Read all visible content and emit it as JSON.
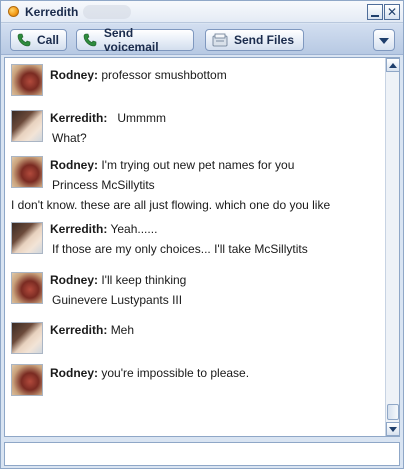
{
  "window": {
    "title": "Kerredith",
    "minimize_label": "",
    "close_label": "✕"
  },
  "toolbar": {
    "call_label": "Call",
    "voicemail_label": "Send voicemail",
    "files_label": "Send Files",
    "menu_icon": "chevron-down-icon"
  },
  "messages": [
    {
      "sender": "Rodney:",
      "lines": [
        "professor smushbottom"
      ]
    },
    {
      "sender": "Kerredith:",
      "lines": [
        "Ummmm",
        "What?"
      ]
    },
    {
      "sender": "Rodney:",
      "lines": [
        "I'm trying out new pet names for you",
        "Princess McSillytits",
        "I don't know. these are all just flowing. which one do you like"
      ]
    },
    {
      "sender": "Kerredith:",
      "lines": [
        "Yeah......",
        "If those are my only choices... I'll take McSillytits"
      ]
    },
    {
      "sender": "Rodney:",
      "lines": [
        "I'll keep thinking",
        "Guinevere Lustypants III"
      ]
    },
    {
      "sender": "Kerredith:",
      "lines": [
        "Meh"
      ]
    },
    {
      "sender": "Rodney:",
      "lines": [
        "you're impossible to please."
      ]
    }
  ],
  "input": {
    "value": "",
    "placeholder": ""
  },
  "colors": {
    "window_bg": "#d9e4f2",
    "toolbar_bg": "#b7c9e3",
    "text_dark": "#1a2b4c",
    "status_online": "#f39a16"
  }
}
